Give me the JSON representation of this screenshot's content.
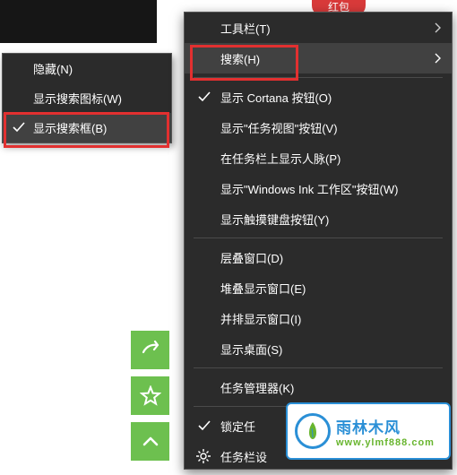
{
  "red_bubble": "红包",
  "left_menu": {
    "items": [
      {
        "label": "隐藏(N)",
        "checked": false
      },
      {
        "label": "显示搜索图标(W)",
        "checked": false
      },
      {
        "label": "显示搜索框(B)",
        "checked": true
      }
    ]
  },
  "right_menu": {
    "groups": [
      [
        {
          "label": "工具栏(T)",
          "submenu": true
        },
        {
          "label": "搜索(H)",
          "submenu": true,
          "hover": true
        }
      ],
      [
        {
          "label": "显示 Cortana 按钮(O)",
          "checked": true
        },
        {
          "label": "显示\"任务视图\"按钮(V)"
        },
        {
          "label": "在任务栏上显示人脉(P)"
        },
        {
          "label": "显示\"Windows Ink 工作区\"按钮(W)"
        },
        {
          "label": "显示触摸键盘按钮(Y)"
        }
      ],
      [
        {
          "label": "层叠窗口(D)"
        },
        {
          "label": "堆叠显示窗口(E)"
        },
        {
          "label": "并排显示窗口(I)"
        },
        {
          "label": "显示桌面(S)"
        }
      ],
      [
        {
          "label": "任务管理器(K)"
        }
      ],
      [
        {
          "label": "锁定任",
          "checked": true
        },
        {
          "label": "任务栏设",
          "icon": "gear"
        }
      ]
    ]
  },
  "logo": {
    "cn": "雨林木风",
    "url": "www.ylmf888.com"
  }
}
